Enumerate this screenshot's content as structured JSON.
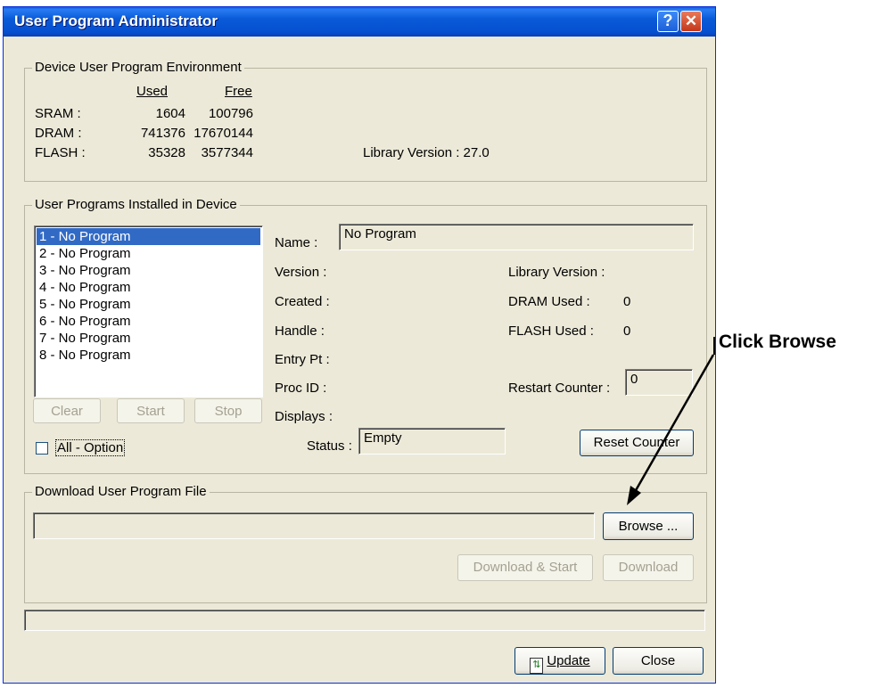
{
  "window": {
    "title": "User Program Administrator",
    "help_button": "?",
    "close_button": "✕"
  },
  "device_env": {
    "group_title": "Device User Program Environment",
    "col_used": "Used",
    "col_free": "Free",
    "rows": [
      {
        "label": "SRAM :",
        "used": "1604",
        "free": "100796"
      },
      {
        "label": "DRAM :",
        "used": "741376",
        "free": "17670144"
      },
      {
        "label": "FLASH :",
        "used": "35328",
        "free": "3577344"
      }
    ],
    "library_version": "Library Version : 27.0"
  },
  "installed": {
    "group_title": "User Programs Installed in Device",
    "programs": [
      "1 - No Program",
      "2 - No Program",
      "3 - No Program",
      "4 - No Program",
      "5 - No Program",
      "6 - No Program",
      "7 - No Program",
      "8 - No Program"
    ],
    "selected_index": 0,
    "name_label": "Name :",
    "name_value": "No Program",
    "version_label": "Version :",
    "created_label": "Created :",
    "handle_label": "Handle :",
    "entry_label": "Entry Pt :",
    "procid_label": "Proc ID :",
    "displays_label": "Displays :",
    "lib_version_label": "Library Version :",
    "dram_used_label": "DRAM Used :",
    "dram_used_value": "0",
    "flash_used_label": "FLASH Used :",
    "flash_used_value": "0",
    "restart_label": "Restart Counter :",
    "restart_value": "0",
    "status_label": "Status :",
    "status_value": "Empty",
    "clear_label": "Clear",
    "start_label": "Start",
    "stop_label": "Stop",
    "all_option_label": "All - Option",
    "reset_label": "Reset Counter"
  },
  "download": {
    "group_title": "Download User Program File",
    "file_value": "",
    "browse_label": "Browse ...",
    "download_start_label": "Download & Start",
    "download_label": "Download"
  },
  "footer": {
    "update_label": "Update",
    "close_label": "Close"
  },
  "annotation": {
    "text": "Click Browse"
  }
}
